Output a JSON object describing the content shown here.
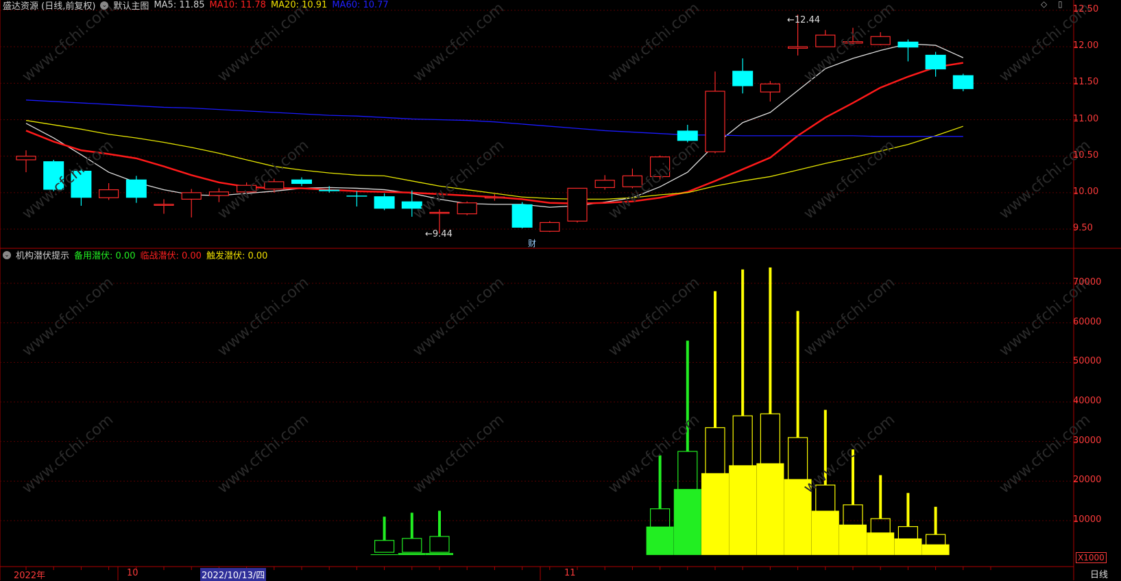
{
  "header": {
    "stock_name": "盛达资源 (日线,前复权)",
    "template": "默认主图",
    "ma5": "MA5: 11.85",
    "ma10": "MA10: 11.78",
    "ma20": "MA20: 10.91",
    "ma60": "MA60: 10.77"
  },
  "indicator": {
    "name": "机构潜伏提示",
    "s1": "备用潜伏: 0.00",
    "s2": "临战潜伏: 0.00",
    "s3": "触发潜伏: 0.00",
    "multiplier": "X1000"
  },
  "top_icons": "◇ ▯",
  "x_axis": {
    "year": "2022年",
    "oct": "10",
    "selected_date": "2022/10/13/四",
    "nov": "11"
  },
  "period": "日线",
  "annotations": {
    "high": "12.44",
    "low": "9.44",
    "fin_marker": "财"
  },
  "colors": {
    "up": "#ff2a2a",
    "down": "#00ffff",
    "ma5": "#e0e0e0",
    "ma10": "#ff1a1a",
    "ma20": "#e6e600",
    "ma60": "#1a1aff",
    "grid": "#5a0000",
    "green": "#22ee22",
    "yellow": "#ffff00"
  },
  "chart_data": [
    {
      "type": "candlestick",
      "yticks": [
        "12.50",
        "12.00",
        "11.50",
        "11.00",
        "10.50",
        "10.00",
        "9.50"
      ],
      "ylim": [
        9.3,
        12.55
      ],
      "candles": [
        {
          "o": 10.45,
          "c": 10.5,
          "h": 10.58,
          "l": 10.28
        },
        {
          "o": 10.43,
          "c": 10.04,
          "h": 10.45,
          "l": 10.02
        },
        {
          "o": 10.3,
          "c": 9.93,
          "h": 10.33,
          "l": 9.82
        },
        {
          "o": 9.93,
          "c": 10.04,
          "h": 10.13,
          "l": 9.9
        },
        {
          "o": 10.18,
          "c": 9.93,
          "h": 10.23,
          "l": 9.86
        },
        {
          "o": 9.83,
          "c": 9.84,
          "h": 9.91,
          "l": 9.71
        },
        {
          "o": 9.91,
          "c": 10.0,
          "h": 10.05,
          "l": 9.66
        },
        {
          "o": 9.96,
          "c": 10.01,
          "h": 10.06,
          "l": 9.87
        },
        {
          "o": 10.01,
          "c": 10.1,
          "h": 10.14,
          "l": 9.98
        },
        {
          "o": 10.05,
          "c": 10.15,
          "h": 10.19,
          "l": 10.0
        },
        {
          "o": 10.18,
          "c": 10.12,
          "h": 10.21,
          "l": 10.09
        },
        {
          "o": 10.04,
          "c": 10.02,
          "h": 10.09,
          "l": 10.0
        },
        {
          "o": 9.96,
          "c": 9.95,
          "h": 10.02,
          "l": 9.81
        },
        {
          "o": 9.95,
          "c": 9.78,
          "h": 9.99,
          "l": 9.76
        },
        {
          "o": 9.88,
          "c": 9.78,
          "h": 10.03,
          "l": 9.67
        },
        {
          "o": 9.72,
          "c": 9.73,
          "h": 9.77,
          "l": 9.44
        },
        {
          "o": 9.71,
          "c": 9.86,
          "h": 9.88,
          "l": 9.69
        },
        {
          "o": 9.93,
          "c": 9.94,
          "h": 9.98,
          "l": 9.89
        },
        {
          "o": 9.84,
          "c": 9.52,
          "h": 9.87,
          "l": 9.51
        },
        {
          "o": 9.47,
          "c": 9.59,
          "h": 9.61,
          "l": 9.46
        },
        {
          "o": 9.61,
          "c": 10.06,
          "h": 10.06,
          "l": 9.59
        },
        {
          "o": 10.07,
          "c": 10.17,
          "h": 10.24,
          "l": 10.04
        },
        {
          "o": 10.08,
          "c": 10.23,
          "h": 10.33,
          "l": 10.06
        },
        {
          "o": 10.22,
          "c": 10.49,
          "h": 10.51,
          "l": 10.18
        },
        {
          "o": 10.85,
          "c": 10.71,
          "h": 10.93,
          "l": 10.69
        },
        {
          "o": 10.56,
          "c": 11.39,
          "h": 11.66,
          "l": 10.54
        },
        {
          "o": 11.67,
          "c": 11.46,
          "h": 11.84,
          "l": 11.36
        },
        {
          "o": 11.38,
          "c": 11.49,
          "h": 11.53,
          "l": 11.25
        },
        {
          "o": 11.98,
          "c": 12.0,
          "h": 12.44,
          "l": 11.88
        },
        {
          "o": 12.0,
          "c": 12.16,
          "h": 12.23,
          "l": 12.0
        },
        {
          "o": 12.05,
          "c": 12.07,
          "h": 12.26,
          "l": 12.04
        },
        {
          "o": 12.03,
          "c": 12.14,
          "h": 12.2,
          "l": 12.02
        },
        {
          "o": 12.07,
          "c": 11.99,
          "h": 12.1,
          "l": 11.8
        },
        {
          "o": 11.89,
          "c": 11.69,
          "h": 11.93,
          "l": 11.59
        },
        {
          "o": 11.61,
          "c": 11.42,
          "h": 11.63,
          "l": 11.39
        }
      ],
      "ma": [
        {
          "name": "MA5",
          "values": [
            10.95,
            10.75,
            10.52,
            10.28,
            10.14,
            10.04,
            9.97,
            9.96,
            9.99,
            10.02,
            10.06,
            10.07,
            10.06,
            10.04,
            9.99,
            9.91,
            9.85,
            9.84,
            9.84,
            9.8,
            9.82,
            9.87,
            9.93,
            10.08,
            10.28,
            10.66,
            10.96,
            11.1,
            11.4,
            11.7,
            11.84,
            11.95,
            12.04,
            12.02,
            11.85
          ]
        },
        {
          "name": "MA10",
          "values": [
            10.85,
            10.7,
            10.58,
            10.53,
            10.47,
            10.36,
            10.24,
            10.14,
            10.08,
            10.06,
            10.06,
            10.04,
            10.02,
            10.01,
            10.0,
            9.98,
            9.96,
            9.94,
            9.91,
            9.86,
            9.85,
            9.86,
            9.88,
            9.93,
            10.01,
            10.16,
            10.32,
            10.48,
            10.78,
            11.03,
            11.23,
            11.44,
            11.59,
            11.72,
            11.78
          ]
        },
        {
          "name": "MA20",
          "values": [
            10.99,
            10.93,
            10.87,
            10.8,
            10.75,
            10.69,
            10.62,
            10.54,
            10.45,
            10.36,
            10.31,
            10.27,
            10.24,
            10.23,
            10.16,
            10.09,
            10.04,
            9.99,
            9.94,
            9.92,
            9.91,
            9.91,
            9.93,
            9.97,
            10.0,
            10.09,
            10.16,
            10.22,
            10.31,
            10.4,
            10.48,
            10.57,
            10.66,
            10.78,
            10.91
          ]
        },
        {
          "name": "MA60",
          "values": [
            11.27,
            11.25,
            11.23,
            11.21,
            11.19,
            11.17,
            11.16,
            11.14,
            11.12,
            11.1,
            11.08,
            11.06,
            11.05,
            11.03,
            11.01,
            11.0,
            10.99,
            10.97,
            10.94,
            10.91,
            10.88,
            10.85,
            10.83,
            10.81,
            10.79,
            10.79,
            10.78,
            10.78,
            10.78,
            10.78,
            10.78,
            10.77,
            10.77,
            10.77,
            10.77
          ]
        }
      ]
    },
    {
      "type": "bar",
      "title": "机构潜伏提示",
      "yticks": [
        "70000",
        "60000",
        "50000",
        "40000",
        "30000",
        "20000",
        "10000"
      ],
      "ylim": [
        0,
        77000
      ],
      "unit_multiplier": "X1000",
      "bars": [
        {
          "i": 13,
          "color": "green",
          "hi": 11000,
          "box": 5000,
          "solid": 1500
        },
        {
          "i": 14,
          "color": "green",
          "hi": 12000,
          "box": 5500,
          "solid": 1800
        },
        {
          "i": 15,
          "color": "green",
          "hi": 12500,
          "box": 6000,
          "solid": 1800
        },
        {
          "i": 23,
          "color": "green",
          "hi": 26500,
          "box": 13000,
          "solid": 8500
        },
        {
          "i": 24,
          "color": "green",
          "hi": 55500,
          "box": 27500,
          "solid": 18000
        },
        {
          "i": 25,
          "color": "yellow",
          "hi": 68000,
          "box": 33500,
          "solid": 22000
        },
        {
          "i": 26,
          "color": "yellow",
          "hi": 73500,
          "box": 36500,
          "solid": 24000
        },
        {
          "i": 27,
          "color": "yellow",
          "hi": 74000,
          "box": 37000,
          "solid": 24500
        },
        {
          "i": 28,
          "color": "yellow",
          "hi": 63000,
          "box": 31000,
          "solid": 20500
        },
        {
          "i": 29,
          "color": "yellow",
          "hi": 38000,
          "box": 19000,
          "solid": 12500
        },
        {
          "i": 30,
          "color": "yellow",
          "hi": 28000,
          "box": 14000,
          "solid": 9000
        },
        {
          "i": 31,
          "color": "yellow",
          "hi": 21500,
          "box": 10500,
          "solid": 7000
        },
        {
          "i": 32,
          "color": "yellow",
          "hi": 17000,
          "box": 8500,
          "solid": 5500
        },
        {
          "i": 33,
          "color": "yellow",
          "hi": 13500,
          "box": 6500,
          "solid": 4000
        }
      ]
    }
  ]
}
